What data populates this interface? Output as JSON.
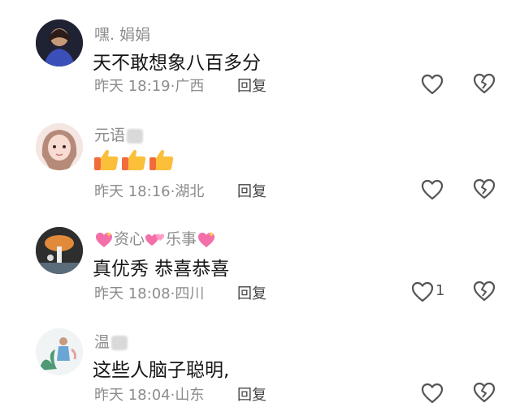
{
  "comments": [
    {
      "name": "嘿.  娟娟",
      "text": "天不敢想象八百多分",
      "time": "昨天 18:19",
      "location": "广西",
      "reply": "回复",
      "likes": ""
    },
    {
      "name": "元语",
      "text": "",
      "time": "昨天 18:16",
      "location": "湖北",
      "reply": "回复",
      "likes": ""
    },
    {
      "name_parts": [
        "资心",
        "乐事"
      ],
      "text": "真优秀  恭喜恭喜",
      "time": "昨天 18:08",
      "location": "四川",
      "reply": "回复",
      "likes": "1"
    },
    {
      "name": "温",
      "text": "这些人脑子聪明,",
      "time": "昨天 18:04",
      "location": "山东",
      "reply": "回复",
      "likes": ""
    }
  ],
  "separator": "·",
  "colors": {
    "meta": "#8c8c8c",
    "text": "#161616",
    "icon": "#555555"
  }
}
